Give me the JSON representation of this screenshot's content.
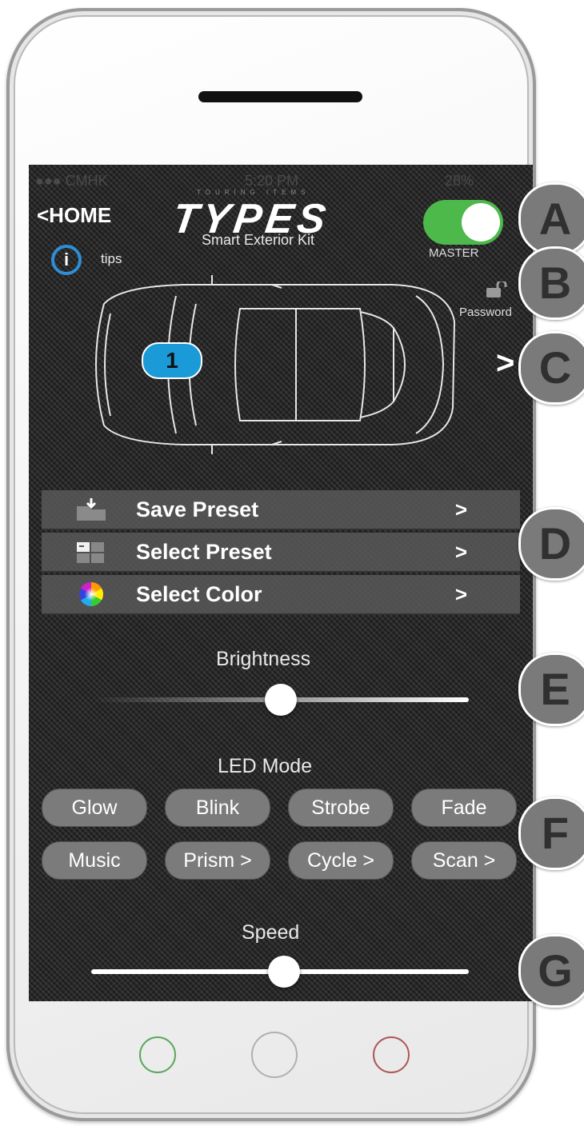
{
  "status_bar": {
    "carrier": "●●● CMHK",
    "time": "5:20 PM",
    "battery": "28%"
  },
  "header": {
    "home": "<HOME",
    "logo_tag": "TOURING ITEMS",
    "logo": "TYPES",
    "subtitle": "Smart Exterior Kit",
    "master_label": "MASTER",
    "master_on": true
  },
  "tips": {
    "icon": "i",
    "label": "tips"
  },
  "password": {
    "label": "Password"
  },
  "car": {
    "zone_badge": "1",
    "next": ">"
  },
  "menu": [
    {
      "label": "Save Preset",
      "chevron": ">",
      "icon": "download-folder-icon"
    },
    {
      "label": "Select Preset",
      "chevron": ">",
      "icon": "preset-grid-icon"
    },
    {
      "label": "Select Color",
      "chevron": ">",
      "icon": "color-wheel-icon"
    }
  ],
  "brightness": {
    "label": "Brightness",
    "level": 0.5
  },
  "led_mode": {
    "label": "LED Mode",
    "buttons": [
      "Glow",
      "Blink",
      "Strobe",
      "Fade",
      "Music",
      "Prism >",
      "Cycle >",
      "Scan >"
    ]
  },
  "speed": {
    "label": "Speed",
    "level": 0.51
  },
  "callouts": [
    "A",
    "B",
    "C",
    "D",
    "E",
    "F",
    "G"
  ],
  "colors": {
    "accent_blue": "#1a9ad6",
    "toggle_green": "#4cb94a",
    "callout_grey": "#7a7a7a"
  }
}
